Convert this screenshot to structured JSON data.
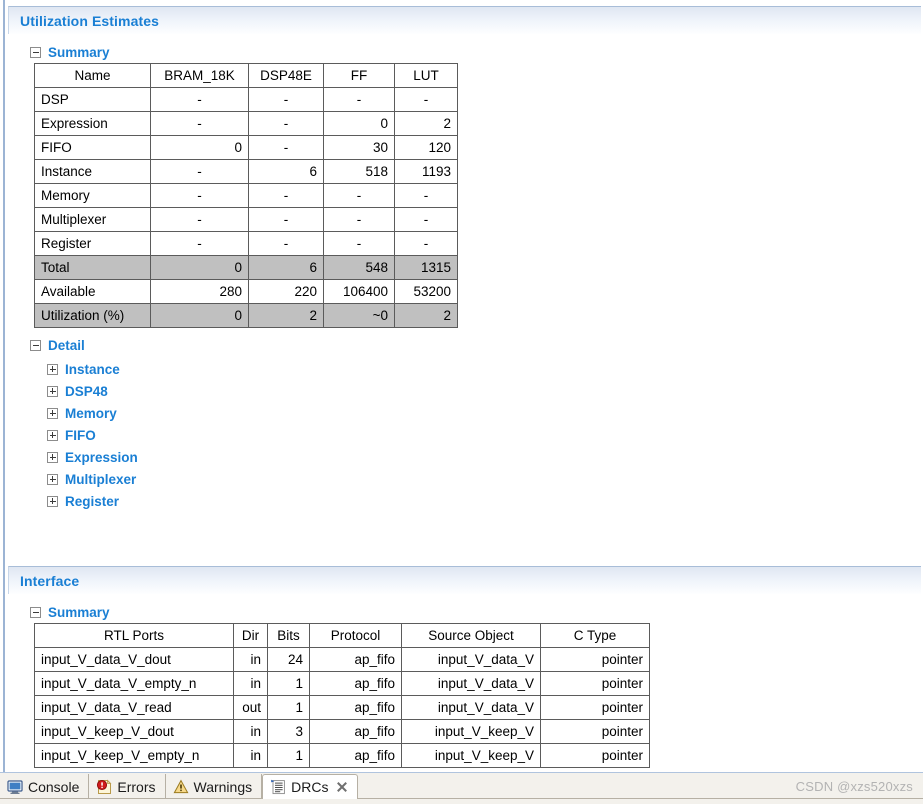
{
  "sections": {
    "utilization": {
      "title": "Utilization Estimates",
      "summary_label": "Summary",
      "detail_label": "Detail",
      "detail_items": [
        {
          "label": "Instance"
        },
        {
          "label": "DSP48"
        },
        {
          "label": "Memory"
        },
        {
          "label": "FIFO"
        },
        {
          "label": "Expression"
        },
        {
          "label": "Multiplexer"
        },
        {
          "label": "Register"
        }
      ],
      "summary_table": {
        "headers": [
          "Name",
          "BRAM_18K",
          "DSP48E",
          "FF",
          "LUT"
        ],
        "rows": [
          {
            "name": "DSP",
            "values": [
              "-",
              "-",
              "-",
              "-"
            ],
            "shaded": false
          },
          {
            "name": "Expression",
            "values": [
              "-",
              "-",
              "0",
              "2"
            ],
            "shaded": false
          },
          {
            "name": "FIFO",
            "values": [
              "0",
              "-",
              "30",
              "120"
            ],
            "shaded": false
          },
          {
            "name": "Instance",
            "values": [
              "-",
              "6",
              "518",
              "1193"
            ],
            "shaded": false
          },
          {
            "name": "Memory",
            "values": [
              "-",
              "-",
              "-",
              "-"
            ],
            "shaded": false
          },
          {
            "name": "Multiplexer",
            "values": [
              "-",
              "-",
              "-",
              "-"
            ],
            "shaded": false
          },
          {
            "name": "Register",
            "values": [
              "-",
              "-",
              "-",
              "-"
            ],
            "shaded": false
          },
          {
            "name": "Total",
            "values": [
              "0",
              "6",
              "548",
              "1315"
            ],
            "shaded": true
          },
          {
            "name": "Available",
            "values": [
              "280",
              "220",
              "106400",
              "53200"
            ],
            "shaded": false
          },
          {
            "name": "Utilization (%)",
            "values": [
              "0",
              "2",
              "~0",
              "2"
            ],
            "shaded": true
          }
        ]
      }
    },
    "interface": {
      "title": "Interface",
      "summary_label": "Summary",
      "summary_table": {
        "headers": [
          "RTL Ports",
          "Dir",
          "Bits",
          "Protocol",
          "Source Object",
          "C Type"
        ],
        "rows": [
          {
            "port": "input_V_data_V_dout",
            "dir": "in",
            "bits": "24",
            "protocol": "ap_fifo",
            "source": "input_V_data_V",
            "ctype": "pointer"
          },
          {
            "port": "input_V_data_V_empty_n",
            "dir": "in",
            "bits": "1",
            "protocol": "ap_fifo",
            "source": "input_V_data_V",
            "ctype": "pointer"
          },
          {
            "port": "input_V_data_V_read",
            "dir": "out",
            "bits": "1",
            "protocol": "ap_fifo",
            "source": "input_V_data_V",
            "ctype": "pointer"
          },
          {
            "port": "input_V_keep_V_dout",
            "dir": "in",
            "bits": "3",
            "protocol": "ap_fifo",
            "source": "input_V_keep_V",
            "ctype": "pointer"
          },
          {
            "port": "input_V_keep_V_empty_n",
            "dir": "in",
            "bits": "1",
            "protocol": "ap_fifo",
            "source": "input_V_keep_V",
            "ctype": "pointer"
          }
        ]
      }
    }
  },
  "tabbar": {
    "tabs": [
      {
        "label": "Console",
        "icon": "console-icon",
        "active": false,
        "closable": false
      },
      {
        "label": "Errors",
        "icon": "error-icon",
        "active": false,
        "closable": false
      },
      {
        "label": "Warnings",
        "icon": "warning-icon",
        "active": false,
        "closable": false
      },
      {
        "label": "DRCs",
        "icon": "drc-icon",
        "active": true,
        "closable": true
      }
    ]
  },
  "watermark": "CSDN @xzs520xzs",
  "colors": {
    "link_blue": "#1a7fd4",
    "panel_border": "#a8bdd8",
    "shaded_row": "#c0c0c0",
    "table_border": "#5b5b5b"
  }
}
